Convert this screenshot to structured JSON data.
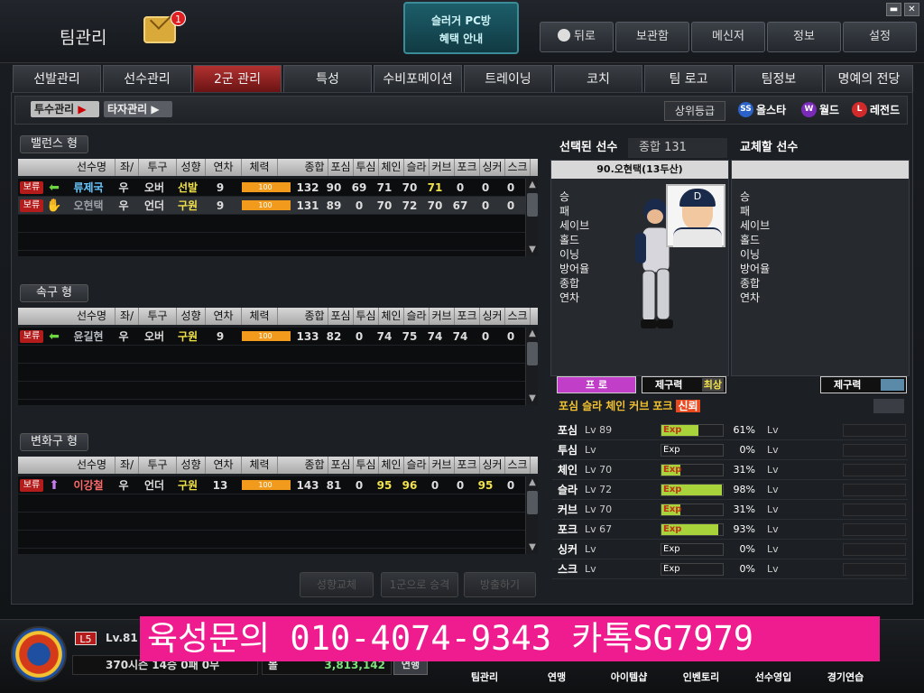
{
  "window": {
    "title": "팀관리",
    "mail_count": "1",
    "promo_line1": "슬러거 PC방",
    "promo_line2": "혜택 안내",
    "ctl_min": "▬",
    "ctl_close": "✕"
  },
  "top_buttons": [
    "뒤로",
    "보관함",
    "메신저",
    "정보",
    "설정"
  ],
  "tabs": [
    "선발관리",
    "선수관리",
    "2군 관리",
    "특성",
    "수비포메이션",
    "트레이닝",
    "코치",
    "팀 로고",
    "팀정보",
    "명예의 전당"
  ],
  "active_tab": "2군 관리",
  "subtabs": {
    "pitcher": "투수관리",
    "batter": "타자관리"
  },
  "rank_button": "상위등급",
  "badges": [
    {
      "abbr": "SS",
      "label": "올스타",
      "color": "#2a62c8"
    },
    {
      "abbr": "W",
      "label": "월드",
      "color": "#7a2ab8"
    },
    {
      "abbr": "L",
      "label": "레전드",
      "color": "#d02a2a"
    }
  ],
  "columns": [
    "선수명",
    "좌/우",
    "투구",
    "성향",
    "연차",
    "체력",
    "종합",
    "포심",
    "투심",
    "체인",
    "슬라",
    "커브",
    "포크",
    "싱커",
    "스크"
  ],
  "groups": [
    {
      "title": "밸런스 형",
      "rows": [
        {
          "status": "보류",
          "icon": "left-arrow",
          "name": "류제국",
          "name_color": "#67c8ff",
          "hand": "우",
          "pitch": "오버",
          "role": "선발",
          "role_color": "#f2e24a",
          "years": "9",
          "stamina": "100",
          "total": "132",
          "stats": [
            "90",
            "69",
            "71",
            "70",
            "71",
            "0",
            "0",
            "0"
          ],
          "hi": [
            4
          ]
        },
        {
          "status": "보류",
          "icon": "hand",
          "name": "오현택",
          "name_color": "#9aa0a6",
          "hand": "우",
          "pitch": "언더",
          "role": "구원",
          "role_color": "#f2e24a",
          "years": "9",
          "stamina": "100",
          "total": "131",
          "stats": [
            "89",
            "0",
            "70",
            "72",
            "70",
            "67",
            "0",
            "0"
          ],
          "hi": [],
          "selected": true
        }
      ]
    },
    {
      "title": "속구 형",
      "rows": [
        {
          "status": "보류",
          "icon": "left-arrow",
          "name": "윤길현",
          "name_color": "#b9bec4",
          "hand": "우",
          "pitch": "오버",
          "role": "구원",
          "role_color": "#f2e24a",
          "years": "9",
          "stamina": "100",
          "total": "133",
          "stats": [
            "82",
            "0",
            "74",
            "75",
            "74",
            "74",
            "0",
            "0"
          ],
          "hi": []
        }
      ]
    },
    {
      "title": "변화구 형",
      "rows": [
        {
          "status": "보류",
          "icon": "up-arrow",
          "name": "이강철",
          "name_color": "#ff6a6a",
          "hand": "우",
          "pitch": "언더",
          "role": "구원",
          "role_color": "#f2e24a",
          "years": "13",
          "stamina": "100",
          "total": "143",
          "stats": [
            "81",
            "0",
            "95",
            "96",
            "0",
            "0",
            "95",
            "0"
          ],
          "hi": [
            2,
            3,
            6
          ]
        }
      ]
    }
  ],
  "actions": [
    "성향교체",
    "1군으로 승격",
    "방출하기"
  ],
  "selected": {
    "header": "선택된 선수",
    "total_label": "종합",
    "total": "131",
    "player": "90.오현택(13두산)",
    "stat_labels": [
      "승",
      "패",
      "세이브",
      "홀드",
      "이닝",
      "방어율",
      "종합",
      "연차"
    ],
    "tag_pro": "프 로",
    "tag_ctrl": "제구력",
    "tag_ctrl_val": "최상",
    "pitch_tags": [
      {
        "t": "포심",
        "c": "#f2c230"
      },
      {
        "t": "슬라",
        "c": "#f2c230"
      },
      {
        "t": "체인",
        "c": "#f2c230"
      },
      {
        "t": "커브",
        "c": "#f2c230"
      },
      {
        "t": "포크",
        "c": "#f2c230"
      },
      {
        "t": "신뢰",
        "c": "#fff"
      }
    ],
    "cap_logo": "D"
  },
  "replace": {
    "header": "교체할 선수",
    "stat_labels": [
      "승",
      "패",
      "세이브",
      "홀드",
      "이닝",
      "방어율",
      "종합",
      "연차"
    ],
    "tag_ctrl": "제구력"
  },
  "pitches": [
    {
      "name": "포심",
      "lv": "Lv 89",
      "exp": "Exp",
      "pct": "61%",
      "fill": 61,
      "lv2": "Lv"
    },
    {
      "name": "투심",
      "lv": "Lv",
      "exp": "Exp",
      "pct": "0%",
      "fill": 0,
      "lv2": "Lv"
    },
    {
      "name": "체인",
      "lv": "Lv 70",
      "exp": "Exp",
      "pct": "31%",
      "fill": 31,
      "lv2": "Lv"
    },
    {
      "name": "슬라",
      "lv": "Lv 72",
      "exp": "Exp",
      "pct": "98%",
      "fill": 98,
      "lv2": "Lv"
    },
    {
      "name": "커브",
      "lv": "Lv 70",
      "exp": "Exp",
      "pct": "31%",
      "fill": 31,
      "lv2": "Lv"
    },
    {
      "name": "포크",
      "lv": "Lv 67",
      "exp": "Exp",
      "pct": "93%",
      "fill": 93,
      "lv2": "Lv"
    },
    {
      "name": "싱커",
      "lv": "Lv",
      "exp": "Exp",
      "pct": "0%",
      "fill": 0,
      "lv2": "Lv"
    },
    {
      "name": "스크",
      "lv": "Lv",
      "exp": "Exp",
      "pct": "0%",
      "fill": 0,
      "lv2": "Lv"
    }
  ],
  "status": {
    "level_badge": "L5",
    "level": "Lv.81",
    "season": "370시즌  14승  0패  0무",
    "money_label": "볼",
    "money": "3,813,142",
    "money_btn": "연행"
  },
  "nav": [
    "팀관리",
    "연맹",
    "아이템샵",
    "인벤토리",
    "선수영입",
    "경기연습"
  ],
  "banner": "육성문의 010-4074-9343 카톡SG7979"
}
